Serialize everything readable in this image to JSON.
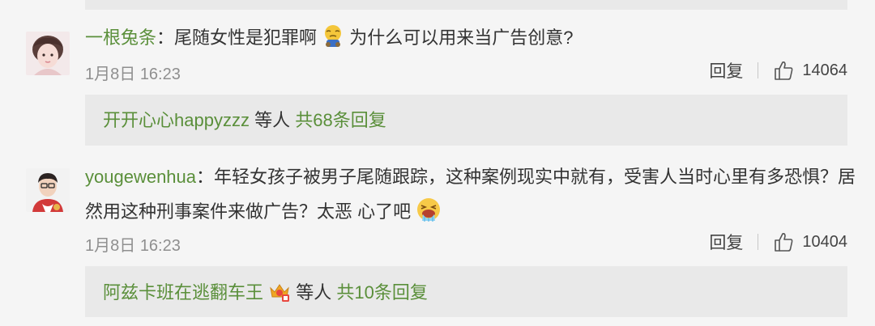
{
  "comments": [
    {
      "username": "一根兔条",
      "text_before_emoji": "：尾随女性是犯罪啊",
      "text_after_emoji": "为什么可以用来当广告创意?",
      "date": "1月8日",
      "time": "16:23",
      "reply_label": "回复",
      "likes": "14064",
      "replies": {
        "user": "开开心心happyzzz",
        "others": "等人",
        "count_text": "共68条回复"
      }
    },
    {
      "username": "yougewenhua",
      "line1": "：年轻女孩子被男子尾随跟踪，这种案例现实中就有，受害人当时心里有多恐惧？居",
      "line2": "然用这种刑事案件来做广告？太恶 心了吧",
      "date": "1月8日",
      "time": "16:23",
      "reply_label": "回复",
      "likes": "10404",
      "replies": {
        "user": "阿兹卡班在逃翻车王",
        "others": "等人",
        "count_text": "共10条回复"
      }
    }
  ],
  "icons": {
    "like": "thumbs-up-icon",
    "emoji1": "crying-emoji-icon",
    "emoji2": "vomit-emoji-icon",
    "badge": "crown-badge-icon"
  },
  "colors": {
    "username": "#5a8f3a",
    "meta": "#8f8f8f",
    "reply_bg": "#e9e9e9",
    "page_bg": "#f5f5f5"
  }
}
